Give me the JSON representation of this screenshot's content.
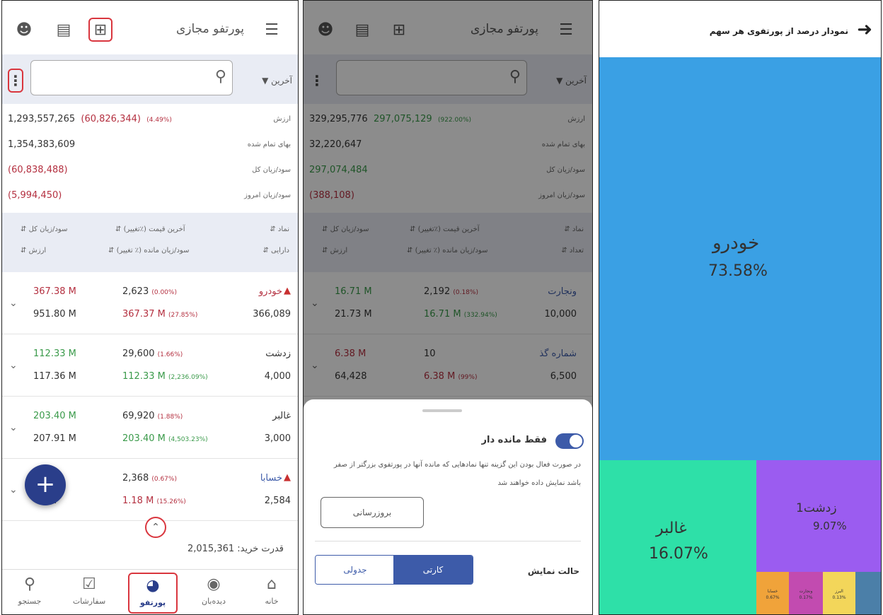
{
  "panel1": {
    "topbar": {
      "title": "پورتفو مجازی"
    },
    "filter": {
      "sort_label": "آخرین",
      "search_placeholder": ""
    },
    "summary": [
      {
        "label": "ارزش",
        "value": "1,293,557,265",
        "change": "(60,826,344)",
        "pct": "(4.49%)"
      },
      {
        "label": "بهای تمام شده",
        "value": "1,354,383,609"
      },
      {
        "label": "سود/زیان کل",
        "value": "(60,838,488)"
      },
      {
        "label": "سود/زیان امروز",
        "value": "(5,994,450)"
      }
    ],
    "headers": {
      "symbol": "نماد",
      "last_price": "آخرین قیمت (٪تغییر)",
      "total_pl": "سود/زیان کل",
      "holding": "دارایی",
      "remaining_pl": "سود/زیان مانده (٪ تغییر)",
      "value": "ارزش"
    },
    "rows": [
      {
        "symbol": "خودرو",
        "warn": true,
        "pl": "367.38 M",
        "value": "951.80 M",
        "price": "2,623",
        "price_pct": "(0.00%)",
        "rem": "367.37 M",
        "rem_pct": "(27.85%)",
        "qty": "366,089"
      },
      {
        "symbol": "زدشت",
        "warn": false,
        "pl": "112.33 M",
        "value": "117.36 M",
        "price": "29,600",
        "price_pct": "(1.66%)",
        "rem": "112.33 M",
        "rem_pct": "(2,236.09%)",
        "qty": "4,000"
      },
      {
        "symbol": "غالبر",
        "warn": false,
        "pl": "203.40 M",
        "value": "207.91 M",
        "price": "69,920",
        "price_pct": "(1.88%)",
        "rem": "203.40 M",
        "rem_pct": "(4,503.23%)",
        "qty": "3,000"
      },
      {
        "symbol": "خسابا",
        "warn": true,
        "pl": "M",
        "value": "M",
        "price": "2,368",
        "price_pct": "(0.67%)",
        "rem": "1.18 M",
        "rem_pct": "(15.26%)",
        "qty": "2,584"
      }
    ],
    "buying_power": "قدرت خرید: 2,015,361",
    "nav": [
      {
        "label": "جستجو",
        "icon": "search-icon"
      },
      {
        "label": "سفارشات",
        "icon": "bag-icon"
      },
      {
        "label": "پورتفو",
        "icon": "pie-chart-icon"
      },
      {
        "label": "دیده‌بان",
        "icon": "eye-icon"
      },
      {
        "label": "خانه",
        "icon": "home-icon"
      }
    ]
  },
  "panel2": {
    "topbar": {
      "title": "پورتفو مجازی"
    },
    "filter": {
      "sort_label": "آخرین"
    },
    "summary": [
      {
        "label": "ارزش",
        "value": "329,295,776",
        "change": "297,075,129",
        "pct": "(922.00%)"
      },
      {
        "label": "بهای تمام شده",
        "value": "32,220,647"
      },
      {
        "label": "سود/زیان کل",
        "value": "297,074,484"
      },
      {
        "label": "سود/زیان امروز",
        "value": "(388,108)"
      }
    ],
    "headers": {
      "symbol": "نماد",
      "last_price": "آخرین قیمت (٪تغییر)",
      "total_pl": "سود/زیان کل",
      "count": "تعداد",
      "remaining_pl": "سود/زیان مانده (٪ تغییر)",
      "value": "ارزش"
    },
    "rows": [
      {
        "symbol": "ونجارت",
        "pl": "16.71 M",
        "value": "21.73 M",
        "price": "2,192",
        "price_pct": "(0.18%)",
        "rem": "16.71 M",
        "rem_pct": "(332.94%)",
        "qty": "10,000"
      },
      {
        "symbol": "شماره گذ",
        "pl": "6.38 M",
        "value": "64,428",
        "price": "10",
        "price_pct": "",
        "rem": "6.38 M",
        "rem_pct": "(99%)",
        "qty": "6,500"
      }
    ],
    "sheet": {
      "toggle_label": "فقط مانده دار",
      "description": "در صورت فعال بودن این گزینه تنها نمادهایی که مانده آنها در پورتفوی بزرگتر از صفر باشد نمایش داده خواهند شد",
      "refresh_label": "بروزرسانی",
      "view_mode_label": "حالت نمایش",
      "view_card": "کارتی",
      "view_table": "جدولی"
    }
  },
  "panel3": {
    "title": "نمودار درصد از پورتفوی هر سهم",
    "colors": {
      "khodro": "#3aa0e4",
      "ghalbar": "#2ee0a8",
      "zdasht": "#9b5cf0",
      "small1": "#f0a33a",
      "small2": "#c24bb0",
      "small3": "#f3d65a",
      "small4": "#4b7fa8"
    },
    "tiles": [
      {
        "name": "خودرو",
        "pct": "73.58%"
      },
      {
        "name": "غالبر",
        "pct": "16.07%"
      },
      {
        "name": "زدشت1",
        "pct": "9.07%"
      },
      {
        "name": "خسابا",
        "pct": "0.67%"
      },
      {
        "name": "ونجارت",
        "pct": "0.17%"
      },
      {
        "name": "البرز",
        "pct": "0.13%"
      }
    ]
  }
}
